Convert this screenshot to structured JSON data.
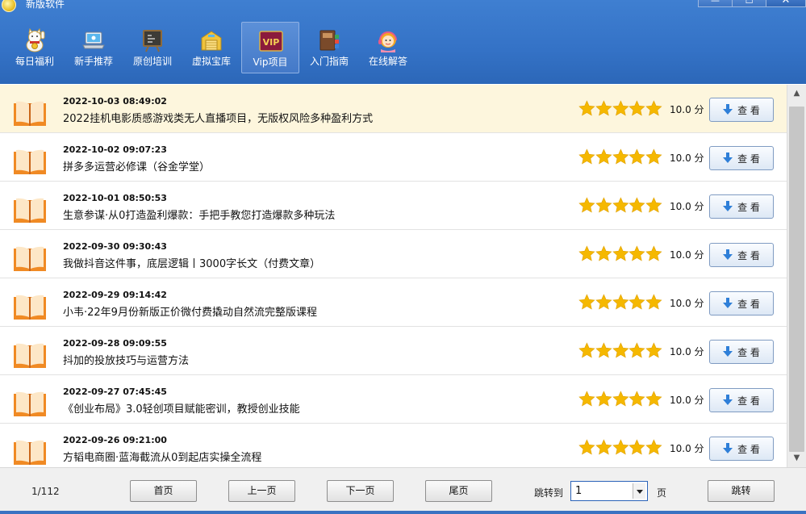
{
  "window": {
    "title": "新版软件",
    "buttons": {
      "minimize": "—",
      "maximize": "☐",
      "close": "✕"
    }
  },
  "toolbar": {
    "items": [
      {
        "label": "每日福利",
        "icon": "lucky-cat-icon",
        "active": false
      },
      {
        "label": "新手推荐",
        "icon": "laptop-icon",
        "active": false
      },
      {
        "label": "原创培训",
        "icon": "chalkboard-icon",
        "active": false
      },
      {
        "label": "虚拟宝库",
        "icon": "warehouse-icon",
        "active": false
      },
      {
        "label": "Vip项目",
        "icon": "vip-icon",
        "icon_text": "VIP",
        "active": true
      },
      {
        "label": "入门指南",
        "icon": "books-icon",
        "active": false
      },
      {
        "label": "在线解答",
        "icon": "support-agent-icon",
        "active": false
      }
    ]
  },
  "list": {
    "selected_index": 0,
    "rating_max": 5,
    "view_label": "查 看",
    "items": [
      {
        "date": "2022-10-03 08:49:02",
        "title": "2022挂机电影质感游戏类无人直播项目，无版权风险多种盈利方式",
        "stars": 5,
        "score": "10.0 分"
      },
      {
        "date": "2022-10-02 09:07:23",
        "title": "拼多多运营必修课（谷金学堂）",
        "stars": 5,
        "score": "10.0 分"
      },
      {
        "date": "2022-10-01 08:50:53",
        "title": "生意参谋·从0打造盈利爆款：手把手教您打造爆款多种玩法",
        "stars": 5,
        "score": "10.0 分"
      },
      {
        "date": "2022-09-30 09:30:43",
        "title": "我做抖音这件事，底层逻辑丨3000字长文（付费文章）",
        "stars": 5,
        "score": "10.0 分"
      },
      {
        "date": "2022-09-29 09:14:42",
        "title": "小韦·22年9月份新版正价微付费撬动自然流完整版课程",
        "stars": 5,
        "score": "10.0 分"
      },
      {
        "date": "2022-09-28 09:09:55",
        "title": "抖加的投放技巧与运营方法",
        "stars": 5,
        "score": "10.0 分"
      },
      {
        "date": "2022-09-27 07:45:45",
        "title": "《创业布局》3.0轻创项目赋能密训，教授创业技能",
        "stars": 5,
        "score": "10.0 分"
      },
      {
        "date": "2022-09-26 09:21:00",
        "title": "方韬电商圈·蓝海截流从0到起店实操全流程",
        "stars": 5,
        "score": "10.0 分"
      }
    ]
  },
  "pagination": {
    "page_info": "1/112",
    "first": "首页",
    "prev": "上一页",
    "next": "下一页",
    "last": "尾页",
    "jump_label": "跳转到",
    "jump_value": "1",
    "page_unit": "页",
    "jump_button": "跳转"
  },
  "colors": {
    "title_bar": "#3472c6",
    "selected_row": "#fdf6dd",
    "star": "#f5b800",
    "book": "#f08a24",
    "view_arrow": "#2f7fd8"
  }
}
